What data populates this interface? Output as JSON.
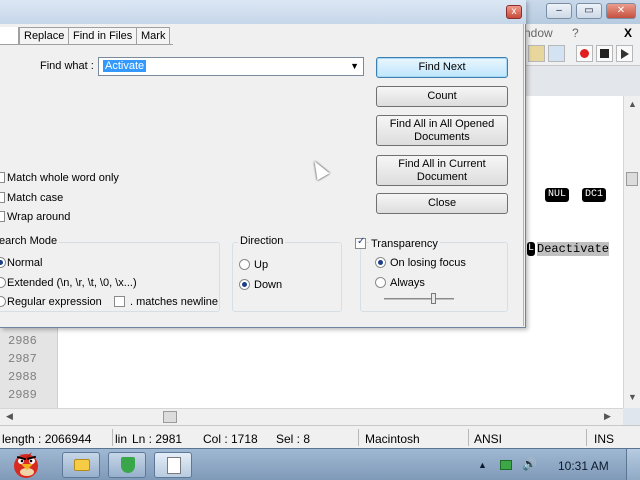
{
  "app": {
    "menu_window": "ndow",
    "menu_help": "?",
    "close_x": "X"
  },
  "editor": {
    "line_numbers": [
      "2986",
      "2987",
      "2988",
      "2989"
    ],
    "ctl_nul": "NUL",
    "ctl_dc1": "DC1",
    "ctl_l": "L",
    "deactivate": "Deactivate"
  },
  "dialog": {
    "close": "x",
    "tabs": [
      "Replace",
      "Find in Files",
      "Mark"
    ],
    "find_label": "Find what :",
    "find_value": "Activate",
    "buttons": {
      "find_next": "Find Next",
      "count": "Count",
      "find_all_opened": "Find All in All Opened Documents",
      "find_all_current": "Find All in Current Document",
      "close": "Close"
    },
    "options": {
      "whole_word": "Match whole word only",
      "match_case": "Match case",
      "wrap_around": "Wrap around"
    },
    "search_mode": {
      "title": "earch Mode",
      "normal": "Normal",
      "extended": "Extended (\\n, \\r, \\t, \\0, \\x...)",
      "regex": "Regular expression",
      "matches_newline": ". matches newline",
      "selected": "normal"
    },
    "direction": {
      "title": "Direction",
      "up": "Up",
      "down": "Down",
      "selected": "down"
    },
    "transparency": {
      "title": "Transparency",
      "checked": true,
      "on_losing_focus": "On losing focus",
      "always": "Always",
      "selected": "on_losing_focus"
    }
  },
  "statusbar": {
    "length": "length : 2066944",
    "lines": "lin",
    "ln": "Ln : 2981",
    "col": "Col : 1718",
    "sel": "Sel : 8",
    "eol": "Macintosh",
    "encoding": "ANSI",
    "mode": "INS"
  },
  "taskbar": {
    "clock": "10:31 AM"
  },
  "colors": {
    "selection": "#3399ff",
    "default_button_border": "#3c7fb1",
    "taskbar": "#8fa9c6"
  }
}
